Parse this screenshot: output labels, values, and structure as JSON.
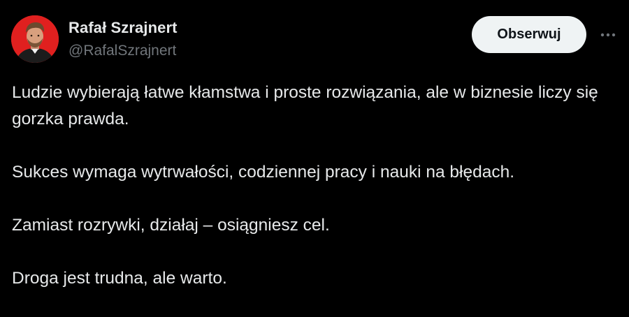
{
  "author": {
    "name": "Rafał Szrajnert",
    "handle": "@RafalSzrajnert",
    "avatar_icon": "profile-photo",
    "avatar_bg": "#e0201f"
  },
  "actions": {
    "follow_label": "Obserwuj",
    "more_icon": "ellipsis-icon"
  },
  "tweet": {
    "paragraphs": [
      "Ludzie wybierają łatwe kłamstwa i proste rozwiązania, ale w biznesie liczy się gorzka prawda.",
      "Sukces wymaga wytrwałości, codziennej pracy i nauki na błędach.",
      "Zamiast rozrywki, działaj – osiągniesz cel.",
      "Droga jest trudna, ale warto."
    ]
  },
  "colors": {
    "background": "#000000",
    "text_primary": "#e7e9ea",
    "text_secondary": "#71767b",
    "button_bg": "#eff3f4",
    "button_text": "#0f1419"
  }
}
